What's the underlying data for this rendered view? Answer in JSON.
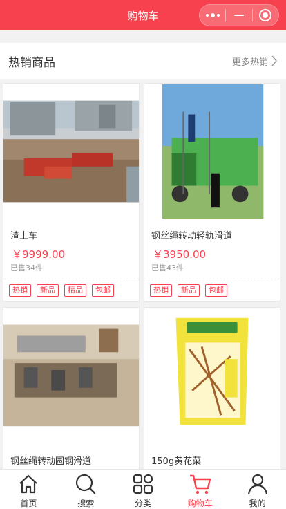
{
  "header": {
    "title": "购物车"
  },
  "section": {
    "title": "热销商品",
    "more": "更多热销"
  },
  "products": [
    {
      "name": "渣土车",
      "price": "￥9999.00",
      "sold": "已售34件",
      "image": "dump-truck-construction-site-photo",
      "tags": [
        "热销",
        "新品",
        "精品",
        "包邮"
      ]
    },
    {
      "name": "钢丝绳转动轻轨滑道",
      "price": "￥3950.00",
      "sold": "已售43件",
      "image": "green-truck-scaffold-photo",
      "tags": [
        "热销",
        "新品",
        "包邮"
      ]
    },
    {
      "name": "钢丝绳转动圆钢滑道",
      "image": "metal-parts-board-photo"
    },
    {
      "name": "150g黄花菜",
      "image": "dried-daylily-package-photo"
    }
  ],
  "tabs": [
    {
      "label": "首页",
      "icon": "home-icon",
      "active": false
    },
    {
      "label": "搜索",
      "icon": "search-icon",
      "active": false
    },
    {
      "label": "分类",
      "icon": "category-icon",
      "active": false
    },
    {
      "label": "购物车",
      "icon": "cart-icon",
      "active": true
    },
    {
      "label": "我的",
      "icon": "user-icon",
      "active": false
    }
  ],
  "colors": {
    "accent": "#f7414e",
    "background": "#f2f2f2"
  }
}
